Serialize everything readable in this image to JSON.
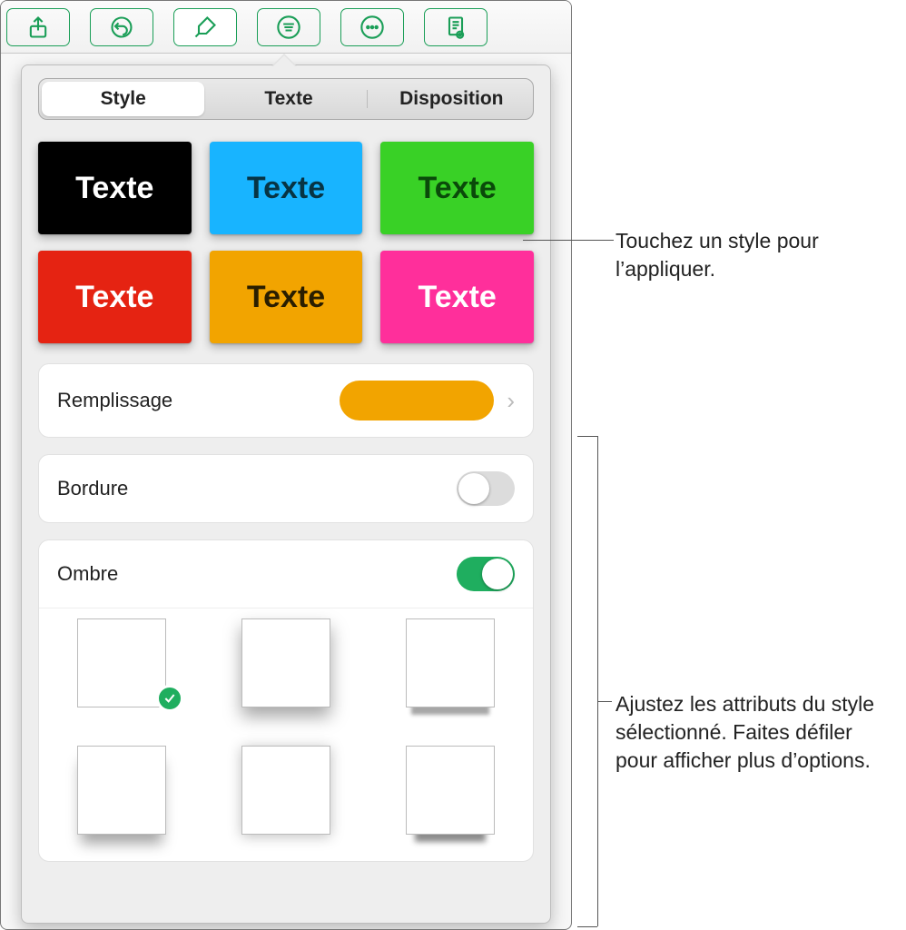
{
  "toolbar": {
    "icons": [
      "share",
      "undo",
      "brush",
      "list",
      "more",
      "document-view"
    ]
  },
  "tabs": {
    "style": "Style",
    "text": "Texte",
    "layout": "Disposition"
  },
  "swatches": [
    {
      "bg": "#000000",
      "fg": "#ffffff",
      "label": "Texte"
    },
    {
      "bg": "#18b4ff",
      "fg": "#0a3a3a",
      "label": "Texte"
    },
    {
      "bg": "#39d126",
      "fg": "#0a4a0a",
      "label": "Texte"
    },
    {
      "bg": "#e52312",
      "fg": "#ffffff",
      "label": "Texte"
    },
    {
      "bg": "#f2a400",
      "fg": "#2a1e00",
      "label": "Texte"
    },
    {
      "bg": "#ff2f9b",
      "fg": "#ffffff",
      "label": "Texte"
    }
  ],
  "controls": {
    "fill_label": "Remplissage",
    "fill_color": "#f2a400",
    "border_label": "Bordure",
    "border_on": false,
    "shadow_label": "Ombre",
    "shadow_on": true
  },
  "callouts": {
    "apply": "Touchez un style pour l’appliquer.",
    "adjust": "Ajustez les attributs du style sélectionné. Faites défiler pour afficher plus d’options."
  }
}
